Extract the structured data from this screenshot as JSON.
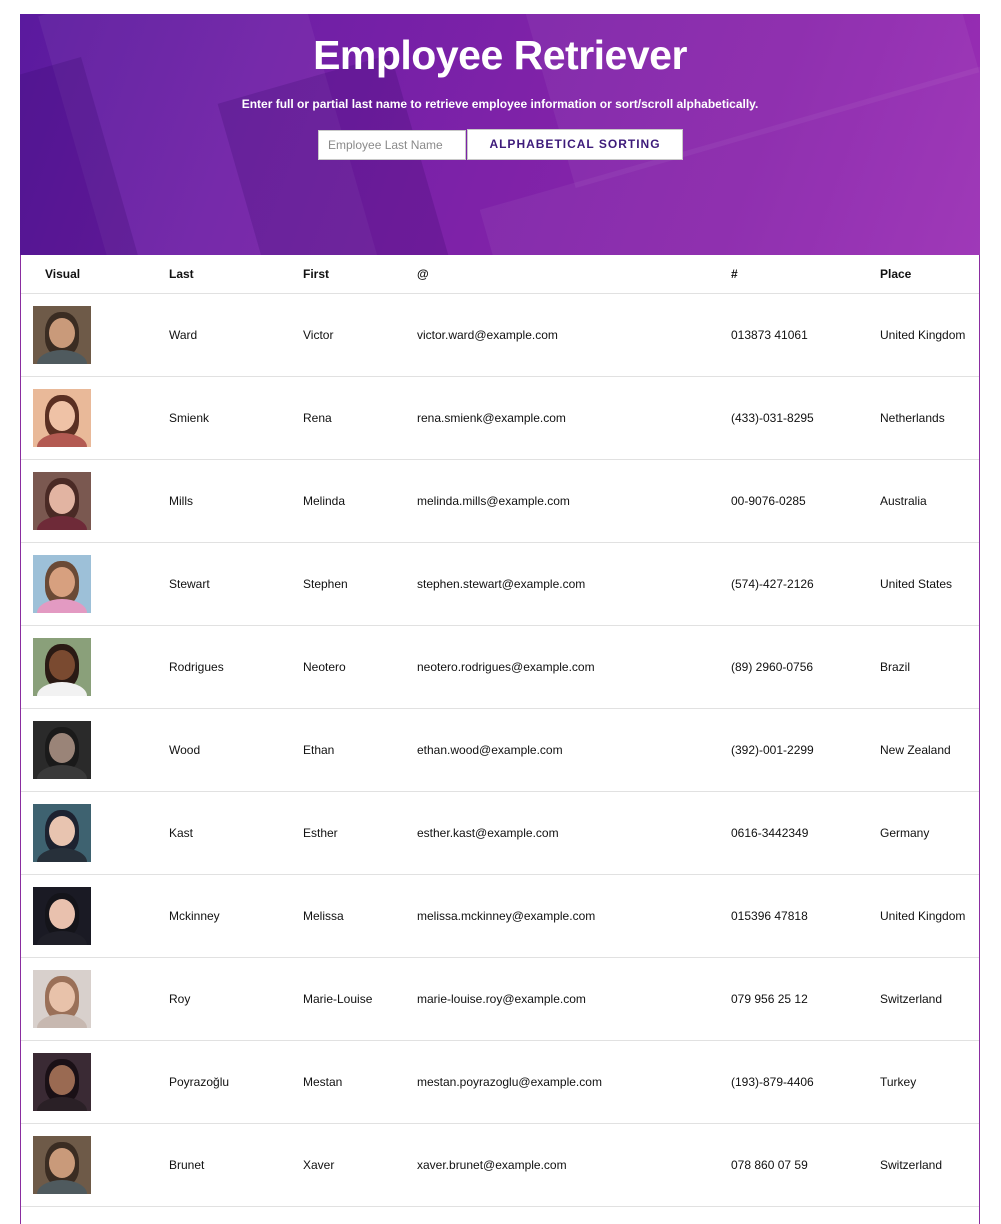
{
  "header": {
    "title": "Employee Retriever",
    "subtitle": "Enter full or partial last name to retrieve employee information or sort/scroll alphabetically.",
    "search_placeholder": "Employee Last Name",
    "sort_button_label": "ALPHABETICAL SORTING"
  },
  "table": {
    "columns": [
      "Visual",
      "Last",
      "First",
      "@",
      "#",
      "Place"
    ],
    "rows": [
      {
        "last": "Ward",
        "first": "Victor",
        "email": "victor.ward@example.com",
        "phone": "013873 41061",
        "place": "United Kingdom",
        "bg": "#6e5a48",
        "skin": "#c99a7a",
        "hair": "#3a2c22",
        "shirt": "#4f5a5e"
      },
      {
        "last": "Smienk",
        "first": "Rena",
        "email": "rena.smienk@example.com",
        "phone": "(433)-031-8295",
        "place": "Netherlands",
        "bg": "#e9b999",
        "skin": "#efc2a6",
        "hair": "#5a2f22",
        "shirt": "#b35a52"
      },
      {
        "last": "Mills",
        "first": "Melinda",
        "email": "melinda.mills@example.com",
        "phone": "00-9076-0285",
        "place": "Australia",
        "bg": "#7a5850",
        "skin": "#e2b4a2",
        "hair": "#4a2a25",
        "shirt": "#6e2a38"
      },
      {
        "last": "Stewart",
        "first": "Stephen",
        "email": "stephen.stewart@example.com",
        "phone": "(574)-427-2126",
        "place": "United States",
        "bg": "#9dc0d8",
        "skin": "#d7a07f",
        "hair": "#6a4a36",
        "shirt": "#e39ac2"
      },
      {
        "last": "Rodrigues",
        "first": "Neotero",
        "email": "neotero.rodrigues@example.com",
        "phone": "(89) 2960-0756",
        "place": "Brazil",
        "bg": "#8aa07a",
        "skin": "#7a4a30",
        "hair": "#2a1a14",
        "shirt": "#f2f2f2"
      },
      {
        "last": "Wood",
        "first": "Ethan",
        "email": "ethan.wood@example.com",
        "phone": "(392)-001-2299",
        "place": "New Zealand",
        "bg": "#2a2a2a",
        "skin": "#9a8478",
        "hair": "#1a1a1a",
        "shirt": "#3a3a3a"
      },
      {
        "last": "Kast",
        "first": "Esther",
        "email": "esther.kast@example.com",
        "phone": "0616-3442349",
        "place": "Germany",
        "bg": "#3e6270",
        "skin": "#e8c4b0",
        "hair": "#1d2230",
        "shirt": "#27303a"
      },
      {
        "last": "Mckinney",
        "first": "Melissa",
        "email": "melissa.mckinney@example.com",
        "phone": "015396 47818",
        "place": "United Kingdom",
        "bg": "#1a1a24",
        "skin": "#e9c1ae",
        "hair": "#14141a",
        "shirt": "#1f1f28"
      },
      {
        "last": "Roy",
        "first": "Marie-Louise",
        "email": "marie-louise.roy@example.com",
        "phone": "079 956 25 12",
        "place": "Switzerland",
        "bg": "#d8d0cc",
        "skin": "#e8c2aa",
        "hair": "#9a7058",
        "shirt": "#c7b8b0"
      },
      {
        "last": "Poyrazoğlu",
        "first": "Mestan",
        "email": "mestan.poyrazoglu@example.com",
        "phone": "(193)-879-4406",
        "place": "Turkey",
        "bg": "#3a2a34",
        "skin": "#9a6a52",
        "hair": "#1a1016",
        "shirt": "#2a2026"
      },
      {
        "last": "Brunet",
        "first": "Xaver",
        "email": "xaver.brunet@example.com",
        "phone": "078 860 07 59",
        "place": "Switzerland",
        "bg": "#6e5a48",
        "skin": "#c99a7a",
        "hair": "#3a2c22",
        "shirt": "#4f5a5e"
      }
    ]
  }
}
